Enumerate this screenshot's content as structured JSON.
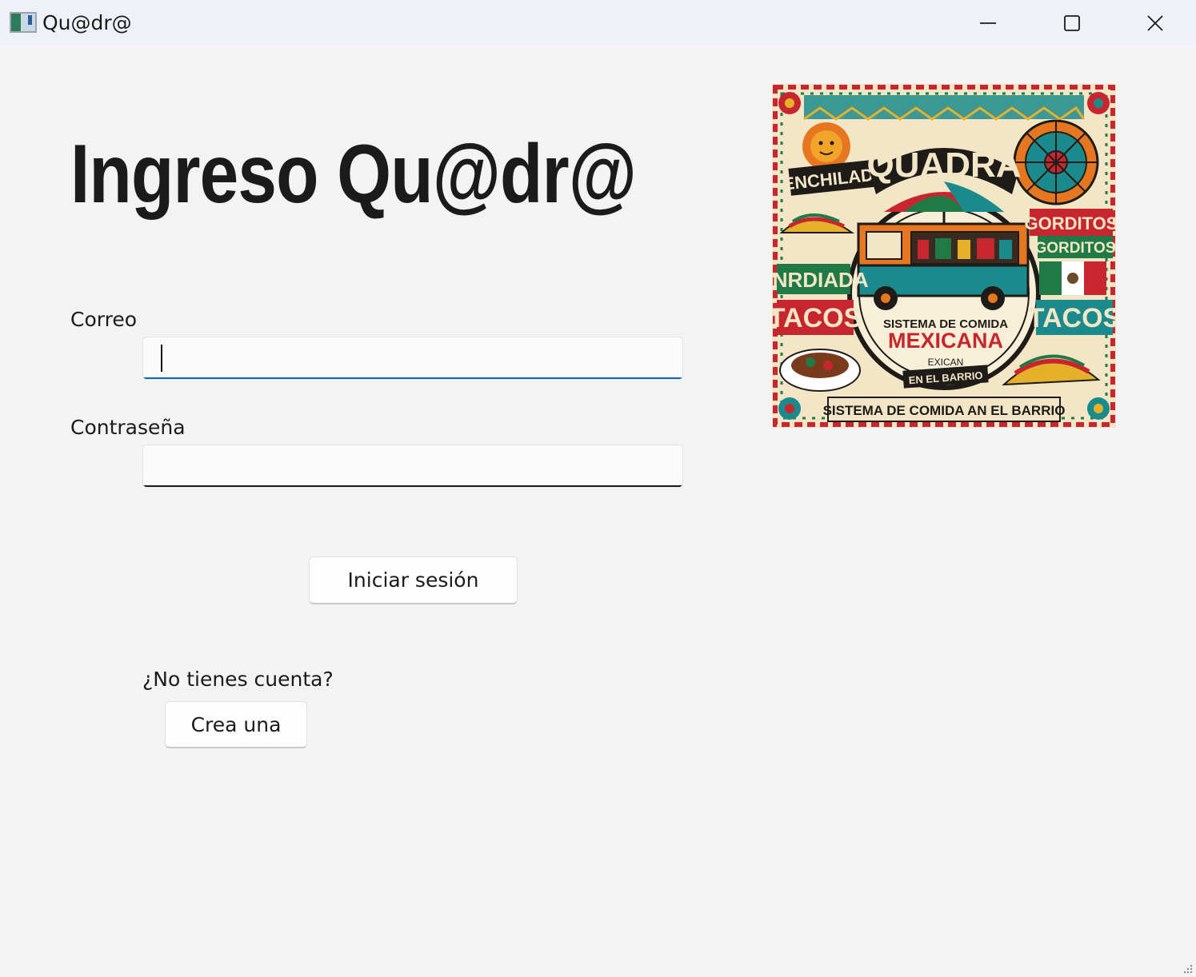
{
  "window": {
    "title": "Qu@dr@",
    "controls": {
      "minimize": "minimize-icon",
      "maximize": "maximize-icon",
      "close": "close-icon"
    }
  },
  "page": {
    "title": "Ingreso Qu@dr@"
  },
  "form": {
    "email_label": "Correo",
    "email_value": "",
    "password_label": "Contraseña",
    "password_value": "",
    "login_button": "Iniciar sesión"
  },
  "signup": {
    "prompt": "¿No tienes cuenta?",
    "button": "Crea una"
  },
  "poster": {
    "brand": "QUADRA",
    "left_top_banner": "ENCHILADA",
    "left_mid_banner": "ENRDIADA",
    "left_bottom_banner": "TACOS",
    "right_top_banner": "GORDITOS",
    "right_top_banner_2": "GORDITOS",
    "right_bottom_banner": "TACOS",
    "center_line_1": "SISTEMA DE COMIDA",
    "center_line_2": "MEXICANA",
    "center_line_3": "EXICAN",
    "center_line_4": "EN EL BARRIO",
    "footer": "SISTEMA DE COMIDA AN EL BARRIO",
    "colors": {
      "cream": "#f3e6c6",
      "red": "#c8262e",
      "green": "#1f7a45",
      "teal": "#1b8a8c",
      "orange": "#e6761f",
      "dark": "#1e1b18"
    }
  }
}
